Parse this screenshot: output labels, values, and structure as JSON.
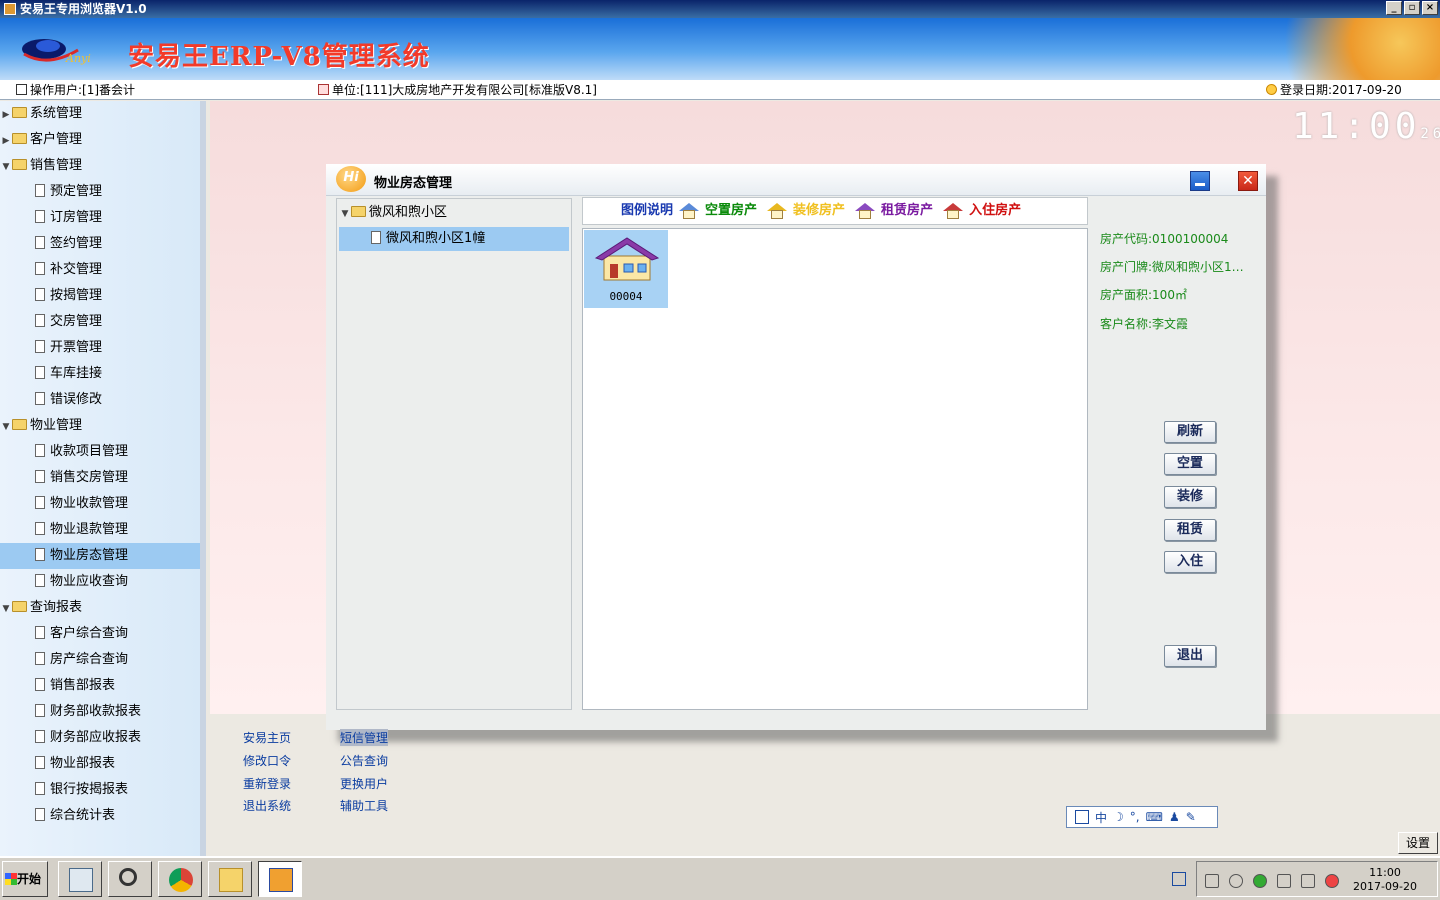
{
  "window": {
    "title": "安易王专用浏览器V1.0",
    "buttons": [
      "_",
      "▫",
      "×"
    ]
  },
  "banner": {
    "title": "安易王ERP-V8管理系统",
    "logo_text": "Anyi"
  },
  "infobar": {
    "operator": "操作用户:[1]番会计",
    "unit": "单位:[111]大成房地产开发有限公司[标准版V8.1]",
    "login_date": "登录日期:2017-09-20"
  },
  "clock": {
    "hm": "11:00",
    "sec": "26"
  },
  "sidebar": {
    "items": [
      {
        "label": "系统管理",
        "type": "folder",
        "expanded": false
      },
      {
        "label": "客户管理",
        "type": "folder",
        "expanded": false
      },
      {
        "label": "销售管理",
        "type": "folder",
        "expanded": true
      },
      {
        "label": "预定管理",
        "type": "doc"
      },
      {
        "label": "订房管理",
        "type": "doc"
      },
      {
        "label": "签约管理",
        "type": "doc"
      },
      {
        "label": "补交管理",
        "type": "doc"
      },
      {
        "label": "按揭管理",
        "type": "doc"
      },
      {
        "label": "交房管理",
        "type": "doc"
      },
      {
        "label": "开票管理",
        "type": "doc"
      },
      {
        "label": "车库挂接",
        "type": "doc"
      },
      {
        "label": "错误修改",
        "type": "doc"
      },
      {
        "label": "物业管理",
        "type": "folder",
        "expanded": true
      },
      {
        "label": "收款项目管理",
        "type": "doc"
      },
      {
        "label": "销售交房管理",
        "type": "doc"
      },
      {
        "label": "物业收款管理",
        "type": "doc"
      },
      {
        "label": "物业退款管理",
        "type": "doc"
      },
      {
        "label": "物业房态管理",
        "type": "doc",
        "selected": true
      },
      {
        "label": "物业应收查询",
        "type": "doc"
      },
      {
        "label": "查询报表",
        "type": "folder",
        "expanded": true
      },
      {
        "label": "客户综合查询",
        "type": "doc"
      },
      {
        "label": "房产综合查询",
        "type": "doc"
      },
      {
        "label": "销售部报表",
        "type": "doc"
      },
      {
        "label": "财务部收款报表",
        "type": "doc"
      },
      {
        "label": "财务部应收报表",
        "type": "doc"
      },
      {
        "label": "物业部报表",
        "type": "doc"
      },
      {
        "label": "银行按揭报表",
        "type": "doc"
      },
      {
        "label": "综合统计表",
        "type": "doc"
      }
    ]
  },
  "dialog": {
    "title": "物业房态管理",
    "hi_icon": "Hi",
    "tree": {
      "root": "微风和煦小区",
      "child": "微风和煦小区1幢"
    },
    "legend": {
      "title": "图例说明",
      "items": [
        {
          "label": "空置房产",
          "color": "#0a8a0a",
          "roof": "#5a8ad8"
        },
        {
          "label": "装修房产",
          "color": "#f0c020",
          "roof": "#e8b820"
        },
        {
          "label": "租赁房产",
          "color": "#7a1aa0",
          "roof": "#8a4ac0"
        },
        {
          "label": "入住房产",
          "color": "#d01010",
          "roof": "#c83a3a"
        }
      ]
    },
    "room": {
      "code": "00004"
    },
    "info": {
      "code": "房产代码:0100100004",
      "door": "房产门牌:微风和煦小区1…",
      "area": "房产面积:100㎡",
      "customer": "客户名称:李文霞"
    },
    "buttons": {
      "refresh": "刷新",
      "vacant": "空置",
      "decorate": "装修",
      "lease": "租赁",
      "occupy": "入住",
      "exit": "退出"
    }
  },
  "bottom_links": {
    "col1": [
      "安易主页",
      "修改口令",
      "重新登录",
      "退出系统"
    ],
    "col2": [
      "短信管理",
      "公告查询",
      "更换用户",
      "辅助工具"
    ]
  },
  "ime": {
    "label": "中"
  },
  "settings_button": "设置",
  "taskbar": {
    "start": "开始",
    "time": "11:00",
    "date": "2017-09-20"
  }
}
